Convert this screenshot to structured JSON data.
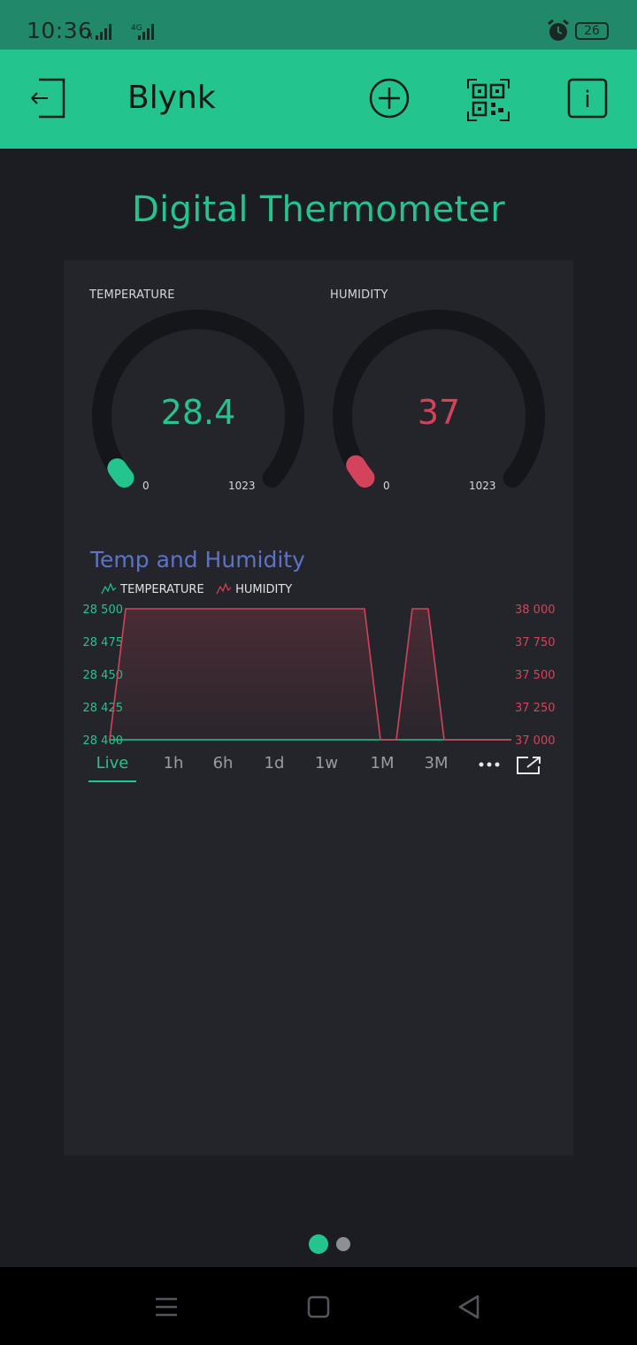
{
  "status_bar": {
    "time": "10:36",
    "network": "4G",
    "battery": "26"
  },
  "app_bar": {
    "title": "Blynk"
  },
  "dashboard": {
    "title": "Digital Thermometer"
  },
  "gauges": [
    {
      "label": "TEMPERATURE",
      "value": "28.4",
      "min": "0",
      "max": "1023",
      "level": 0.0277,
      "color": "#23c48e"
    },
    {
      "label": "HUMIDITY",
      "value": "37",
      "min": "0",
      "max": "1023",
      "level": 0.0362,
      "color": "#d3435c"
    }
  ],
  "chart": {
    "title": "Temp and Humidity",
    "legend": [
      {
        "name": "TEMPERATURE",
        "color": "#23c48e"
      },
      {
        "name": "HUMIDITY",
        "color": "#d3435c"
      }
    ],
    "tabs": [
      "Live",
      "1h",
      "6h",
      "1d",
      "1w",
      "1M",
      "3M"
    ],
    "active_tab": "Live"
  },
  "chart_data": {
    "type": "area",
    "title": "Temp and Humidity",
    "x_ticks": [],
    "y_left": {
      "ticks": [
        "28 500",
        "28 475",
        "28 450",
        "28 425",
        "28 400"
      ],
      "range": [
        28400,
        28500
      ],
      "color": "#23c48e"
    },
    "y_right": {
      "ticks": [
        "38 000",
        "37 750",
        "37 500",
        "37 250",
        "37 000"
      ],
      "range": [
        37000,
        38000
      ],
      "color": "#d3435c"
    },
    "series": [
      {
        "name": "TEMPERATURE",
        "axis": "left",
        "x": [
          0,
          1,
          2,
          3,
          4,
          5,
          6,
          7,
          8,
          9,
          10,
          11,
          12,
          13,
          14,
          15
        ],
        "values": [
          28400,
          28400,
          28400,
          28400,
          28400,
          28400,
          28400,
          28400,
          28400,
          28400,
          28400,
          28400,
          28400,
          28400,
          28400,
          28400
        ]
      },
      {
        "name": "HUMIDITY",
        "axis": "right",
        "x": [
          0,
          1,
          2,
          3,
          4,
          5,
          6,
          7,
          8,
          9,
          10,
          11,
          12,
          13,
          14,
          15
        ],
        "values": [
          37000,
          38000,
          38000,
          38000,
          38000,
          38000,
          38000,
          38000,
          37000,
          37000,
          38000,
          38000,
          37000,
          37000,
          37000,
          37000
        ]
      }
    ],
    "grid": false,
    "legend_position": "top-left"
  },
  "page_indicator": {
    "pages": 2,
    "current": 0
  }
}
